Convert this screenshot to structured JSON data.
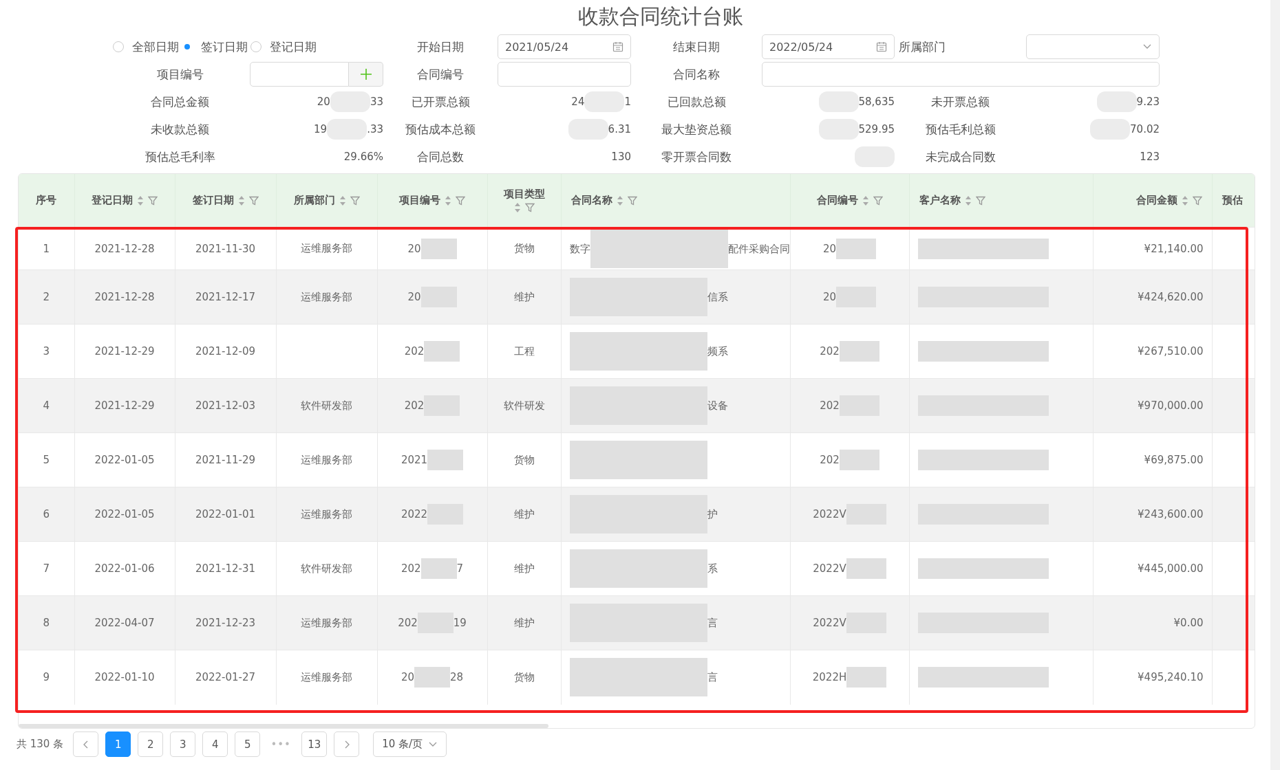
{
  "title": "收款合同统计台账",
  "filters": {
    "date_mode": [
      {
        "label": "全部日期",
        "selected": false
      },
      {
        "label": "签订日期",
        "selected": true
      },
      {
        "label": "登记日期",
        "selected": false
      }
    ],
    "start_date": {
      "label": "开始日期",
      "value": "2021/05/24"
    },
    "end_date": {
      "label": "结束日期",
      "value": "2022/05/24"
    },
    "department": {
      "label": "所属部门"
    },
    "project_no": {
      "label": "项目编号"
    },
    "contract_no": {
      "label": "合同编号"
    },
    "contract_name": {
      "label": "合同名称"
    }
  },
  "stats": [
    {
      "label": "合同总金额",
      "value": [
        {
          "kind": "text",
          "text": "20"
        },
        {
          "kind": "redacted"
        },
        {
          "kind": "text",
          "text": "33"
        }
      ]
    },
    {
      "label": "已开票总额",
      "value": [
        {
          "kind": "text",
          "text": "24"
        },
        {
          "kind": "redacted"
        },
        {
          "kind": "text",
          "text": "1"
        }
      ]
    },
    {
      "label": "已回款总额",
      "value": [
        {
          "kind": "redacted"
        },
        {
          "kind": "text",
          "text": "58,635"
        }
      ]
    },
    {
      "label": "未开票总额",
      "value": [
        {
          "kind": "redacted"
        },
        {
          "kind": "text",
          "text": "9.23"
        }
      ]
    },
    {
      "label": "未收款总额",
      "value": [
        {
          "kind": "text",
          "text": "19"
        },
        {
          "kind": "redacted"
        },
        {
          "kind": "text",
          "text": ".33"
        }
      ]
    },
    {
      "label": "预估成本总额",
      "value": [
        {
          "kind": "redacted"
        },
        {
          "kind": "text",
          "text": "6.31"
        }
      ]
    },
    {
      "label": "最大垫资总额",
      "value": [
        {
          "kind": "redacted"
        },
        {
          "kind": "text",
          "text": "529.95"
        }
      ]
    },
    {
      "label": "预估毛利总额",
      "value": [
        {
          "kind": "redacted"
        },
        {
          "kind": "text",
          "text": "70.02"
        }
      ]
    },
    {
      "label": "预估总毛利率",
      "value": [
        {
          "kind": "text",
          "text": "29.66%"
        }
      ]
    },
    {
      "label": "合同总数",
      "value": [
        {
          "kind": "text",
          "text": "130"
        }
      ]
    },
    {
      "label": "零开票合同数",
      "value": [
        {
          "kind": "redacted"
        }
      ]
    },
    {
      "label": "未完成合同数",
      "value": [
        {
          "kind": "text",
          "text": "123"
        }
      ]
    }
  ],
  "table": {
    "columns": [
      {
        "title": "序号",
        "sortable": false,
        "filterable": false
      },
      {
        "title": "登记日期",
        "sortable": true,
        "filterable": true
      },
      {
        "title": "签订日期",
        "sortable": true,
        "filterable": true
      },
      {
        "title": "所属部门",
        "sortable": true,
        "filterable": true
      },
      {
        "title": "项目编号",
        "sortable": true,
        "filterable": true
      },
      {
        "title": "项目类型",
        "sortable": true,
        "filterable": true
      },
      {
        "title": "合同名称",
        "sortable": true,
        "filterable": true
      },
      {
        "title": "合同编号",
        "sortable": true,
        "filterable": true
      },
      {
        "title": "客户名称",
        "sortable": true,
        "filterable": true
      },
      {
        "title": "合同金额",
        "sortable": true,
        "filterable": true
      },
      {
        "title": "预估",
        "sortable": false,
        "filterable": false
      }
    ],
    "rows": [
      [
        "1",
        "2021-12-28",
        "2021-11-30",
        "运维服务部",
        [
          {
            "kind": "text",
            "text": "20"
          },
          {
            "kind": "redacted"
          }
        ],
        "货物",
        [
          {
            "kind": "text",
            "text": "数字"
          },
          {
            "kind": "redacted"
          },
          {
            "kind": "text",
            "text": "配件采购合同"
          }
        ],
        [
          {
            "kind": "text",
            "text": "20"
          },
          {
            "kind": "redacted"
          }
        ],
        [
          {
            "kind": "redacted"
          }
        ],
        "¥21,140.00",
        null
      ],
      [
        "2",
        "2021-12-28",
        "2021-12-17",
        "运维服务部",
        [
          {
            "kind": "text",
            "text": "20"
          },
          {
            "kind": "redacted"
          }
        ],
        "维护",
        [
          {
            "kind": "redacted"
          },
          {
            "kind": "text",
            "text": "信系"
          }
        ],
        [
          {
            "kind": "text",
            "text": "20"
          },
          {
            "kind": "redacted"
          }
        ],
        [
          {
            "kind": "redacted"
          }
        ],
        "¥424,620.00",
        null
      ],
      [
        "3",
        "2021-12-29",
        "2021-12-09",
        null,
        [
          {
            "kind": "text",
            "text": "202"
          },
          {
            "kind": "redacted"
          }
        ],
        "工程",
        [
          {
            "kind": "redacted"
          },
          {
            "kind": "text",
            "text": "频系"
          }
        ],
        [
          {
            "kind": "text",
            "text": "202"
          },
          {
            "kind": "redacted"
          }
        ],
        [
          {
            "kind": "redacted"
          }
        ],
        "¥267,510.00",
        null
      ],
      [
        "4",
        "2021-12-29",
        "2021-12-03",
        "软件研发部",
        [
          {
            "kind": "text",
            "text": "202"
          },
          {
            "kind": "redacted"
          }
        ],
        "软件研发",
        [
          {
            "kind": "redacted"
          },
          {
            "kind": "text",
            "text": "设备"
          }
        ],
        [
          {
            "kind": "text",
            "text": "202"
          },
          {
            "kind": "redacted"
          }
        ],
        [
          {
            "kind": "redacted"
          }
        ],
        "¥970,000.00",
        null
      ],
      [
        "5",
        "2022-01-05",
        "2021-11-29",
        "运维服务部",
        [
          {
            "kind": "text",
            "text": "2021"
          },
          {
            "kind": "redacted"
          }
        ],
        "货物",
        [
          {
            "kind": "redacted"
          }
        ],
        [
          {
            "kind": "text",
            "text": "202"
          },
          {
            "kind": "redacted"
          }
        ],
        [
          {
            "kind": "redacted"
          }
        ],
        "¥69,875.00",
        null
      ],
      [
        "6",
        "2022-01-05",
        "2022-01-01",
        "运维服务部",
        [
          {
            "kind": "text",
            "text": "2022"
          },
          {
            "kind": "redacted"
          }
        ],
        "维护",
        [
          {
            "kind": "redacted"
          },
          {
            "kind": "text",
            "text": "护"
          }
        ],
        [
          {
            "kind": "text",
            "text": "2022V"
          },
          {
            "kind": "redacted"
          }
        ],
        [
          {
            "kind": "redacted"
          }
        ],
        "¥243,600.00",
        null
      ],
      [
        "7",
        "2022-01-06",
        "2021-12-31",
        "软件研发部",
        [
          {
            "kind": "text",
            "text": "202"
          },
          {
            "kind": "redacted"
          },
          {
            "kind": "text",
            "text": "7"
          }
        ],
        "维护",
        [
          {
            "kind": "redacted"
          },
          {
            "kind": "text",
            "text": "系"
          }
        ],
        [
          {
            "kind": "text",
            "text": "2022V"
          },
          {
            "kind": "redacted"
          }
        ],
        [
          {
            "kind": "redacted"
          }
        ],
        "¥445,000.00",
        null
      ],
      [
        "8",
        "2022-04-07",
        "2021-12-23",
        "运维服务部",
        [
          {
            "kind": "text",
            "text": "202"
          },
          {
            "kind": "redacted"
          },
          {
            "kind": "text",
            "text": "19"
          }
        ],
        "维护",
        [
          {
            "kind": "redacted"
          },
          {
            "kind": "text",
            "text": "言"
          }
        ],
        [
          {
            "kind": "text",
            "text": "2022V"
          },
          {
            "kind": "redacted"
          }
        ],
        [
          {
            "kind": "redacted"
          }
        ],
        "¥0.00",
        null
      ],
      [
        "9",
        "2022-01-10",
        "2022-01-27",
        "运维服务部",
        [
          {
            "kind": "text",
            "text": "20"
          },
          {
            "kind": "redacted"
          },
          {
            "kind": "text",
            "text": "28"
          }
        ],
        "货物",
        [
          {
            "kind": "redacted"
          },
          {
            "kind": "text",
            "text": "言"
          }
        ],
        [
          {
            "kind": "text",
            "text": "2022H"
          },
          {
            "kind": "redacted"
          }
        ],
        [
          {
            "kind": "redacted"
          }
        ],
        "¥495,240.10",
        null
      ]
    ]
  },
  "pagination": {
    "total": "共 130 条",
    "pages": [
      {
        "label": "1",
        "selected": true
      },
      {
        "label": "2",
        "selected": false
      },
      {
        "label": "3",
        "selected": false
      },
      {
        "label": "4",
        "selected": false
      },
      {
        "label": "5",
        "selected": false
      }
    ],
    "ellipsis": "•••",
    "last": {
      "label": "13",
      "selected": false
    },
    "page_size": "10 条/页"
  }
}
